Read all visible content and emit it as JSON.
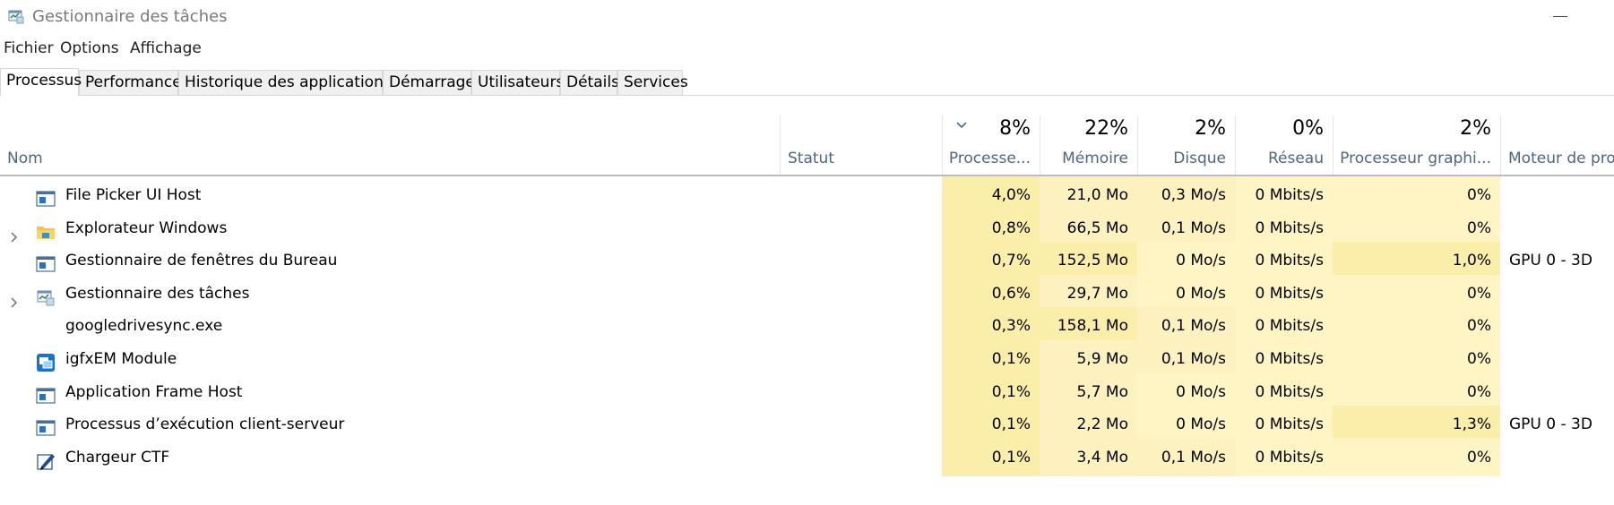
{
  "window": {
    "title": "Gestionnaire des tâches"
  },
  "menu": [
    "Fichier",
    "Options",
    "Affichage"
  ],
  "tabs": [
    "Processus",
    "Performance",
    "Historique des applications",
    "Démarrage",
    "Utilisateurs",
    "Détails",
    "Services"
  ],
  "active_tab": "Processus",
  "columns": {
    "name": "Nom",
    "status": "Statut",
    "cpu": {
      "label": "Processe...",
      "total": "8%"
    },
    "memory": {
      "label": "Mémoire",
      "total": "22%"
    },
    "disk": {
      "label": "Disque",
      "total": "2%"
    },
    "network": {
      "label": "Réseau",
      "total": "0%"
    },
    "gpu": {
      "label": "Processeur graphi...",
      "total": "2%"
    },
    "gpu_engine": {
      "label": "Moteur de proc"
    }
  },
  "processes": [
    {
      "name": "File Picker UI Host",
      "icon": "app-window-icon",
      "expandable": false,
      "cpu": "4,0%",
      "memory": "21,0 Mo",
      "disk": "0,3 Mo/s",
      "network": "0 Mbits/s",
      "gpu": "0%",
      "gpu_engine": ""
    },
    {
      "name": "Explorateur Windows",
      "icon": "folder-icon",
      "expandable": true,
      "cpu": "0,8%",
      "memory": "66,5 Mo",
      "disk": "0,1 Mo/s",
      "network": "0 Mbits/s",
      "gpu": "0%",
      "gpu_engine": ""
    },
    {
      "name": "Gestionnaire de fenêtres du Bureau",
      "icon": "app-window-icon",
      "expandable": false,
      "cpu": "0,7%",
      "memory": "152,5 Mo",
      "disk": "0 Mo/s",
      "network": "0 Mbits/s",
      "gpu": "1,0%",
      "gpu_engine": "GPU 0 - 3D"
    },
    {
      "name": "Gestionnaire des tâches",
      "icon": "task-manager-icon",
      "expandable": true,
      "cpu": "0,6%",
      "memory": "29,7 Mo",
      "disk": "0 Mo/s",
      "network": "0 Mbits/s",
      "gpu": "0%",
      "gpu_engine": ""
    },
    {
      "name": "googledrivesync.exe",
      "icon": "",
      "expandable": false,
      "cpu": "0,3%",
      "memory": "158,1 Mo",
      "disk": "0,1 Mo/s",
      "network": "0 Mbits/s",
      "gpu": "0%",
      "gpu_engine": ""
    },
    {
      "name": "igfxEM Module",
      "icon": "igfx-icon",
      "expandable": false,
      "cpu": "0,1%",
      "memory": "5,9 Mo",
      "disk": "0,1 Mo/s",
      "network": "0 Mbits/s",
      "gpu": "0%",
      "gpu_engine": ""
    },
    {
      "name": "Application Frame Host",
      "icon": "app-window-icon",
      "expandable": false,
      "cpu": "0,1%",
      "memory": "5,7 Mo",
      "disk": "0 Mo/s",
      "network": "0 Mbits/s",
      "gpu": "0%",
      "gpu_engine": ""
    },
    {
      "name": "Processus d’exécution client-serveur",
      "icon": "app-window-icon",
      "expandable": false,
      "cpu": "0,1%",
      "memory": "2,2 Mo",
      "disk": "0 Mo/s",
      "network": "0 Mbits/s",
      "gpu": "1,3%",
      "gpu_engine": "GPU 0 - 3D"
    },
    {
      "name": "Chargeur CTF",
      "icon": "ctf-pen-icon",
      "expandable": false,
      "cpu": "0,1%",
      "memory": "3,4 Mo",
      "disk": "0,1 Mo/s",
      "network": "0 Mbits/s",
      "gpu": "0%",
      "gpu_engine": ""
    }
  ],
  "colors": {
    "heat_strong": "#fbeeaa",
    "heat_medium": "#fcf1bf",
    "heat_light": "#fff4c4",
    "header_label": "#4f6680"
  }
}
